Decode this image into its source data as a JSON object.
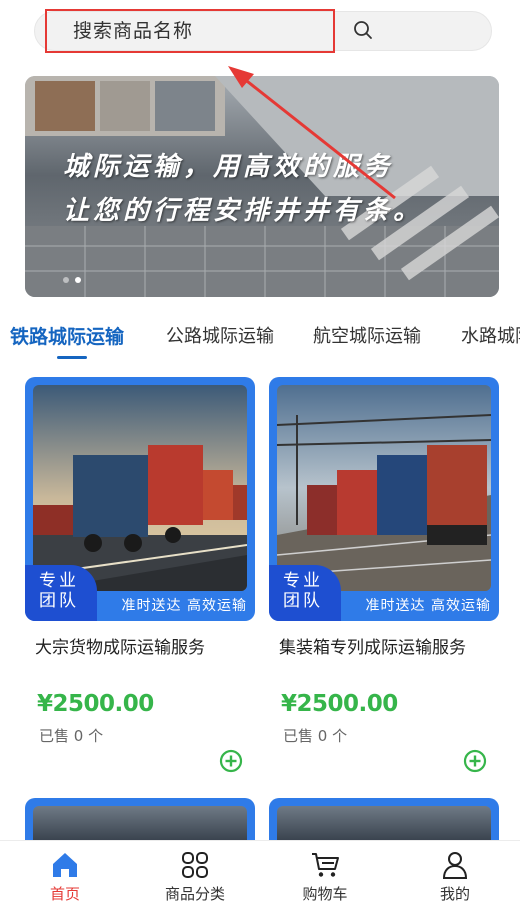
{
  "search": {
    "placeholder": "搜索商品名称",
    "icon": "search-icon"
  },
  "banner": {
    "line1": "城际运输，用高效的服务",
    "line2": "让您的行程安排井井有条。",
    "dots": 2,
    "active_dot": 1
  },
  "tabs": [
    {
      "label": "铁路城际运输",
      "active": true
    },
    {
      "label": "公路城际运输",
      "active": false
    },
    {
      "label": "航空城际运输",
      "active": false
    },
    {
      "label": "水路城际",
      "active": false
    }
  ],
  "products": [
    {
      "badge_line1": "专业",
      "badge_line2": "团队",
      "tags": "准时送达  高效运输",
      "title": "大宗货物成际运输服务",
      "price": "¥2500.00",
      "sold": "已售 0 个"
    },
    {
      "badge_line1": "专业",
      "badge_line2": "团队",
      "tags": "准时送达  高效运输",
      "title": "集装箱专列成际运输服务",
      "price": "¥2500.00",
      "sold": "已售 0 个"
    }
  ],
  "nav": [
    {
      "label": "首页",
      "icon": "home-icon",
      "active": true
    },
    {
      "label": "商品分类",
      "icon": "category-grid-icon",
      "active": false
    },
    {
      "label": "购物车",
      "icon": "cart-icon",
      "active": false
    },
    {
      "label": "我的",
      "icon": "user-icon",
      "active": false
    }
  ],
  "colors": {
    "accent_blue": "#1565c0",
    "card_blue": "#2f7be8",
    "price_green": "#36b54a",
    "highlight_red": "#e53935"
  }
}
